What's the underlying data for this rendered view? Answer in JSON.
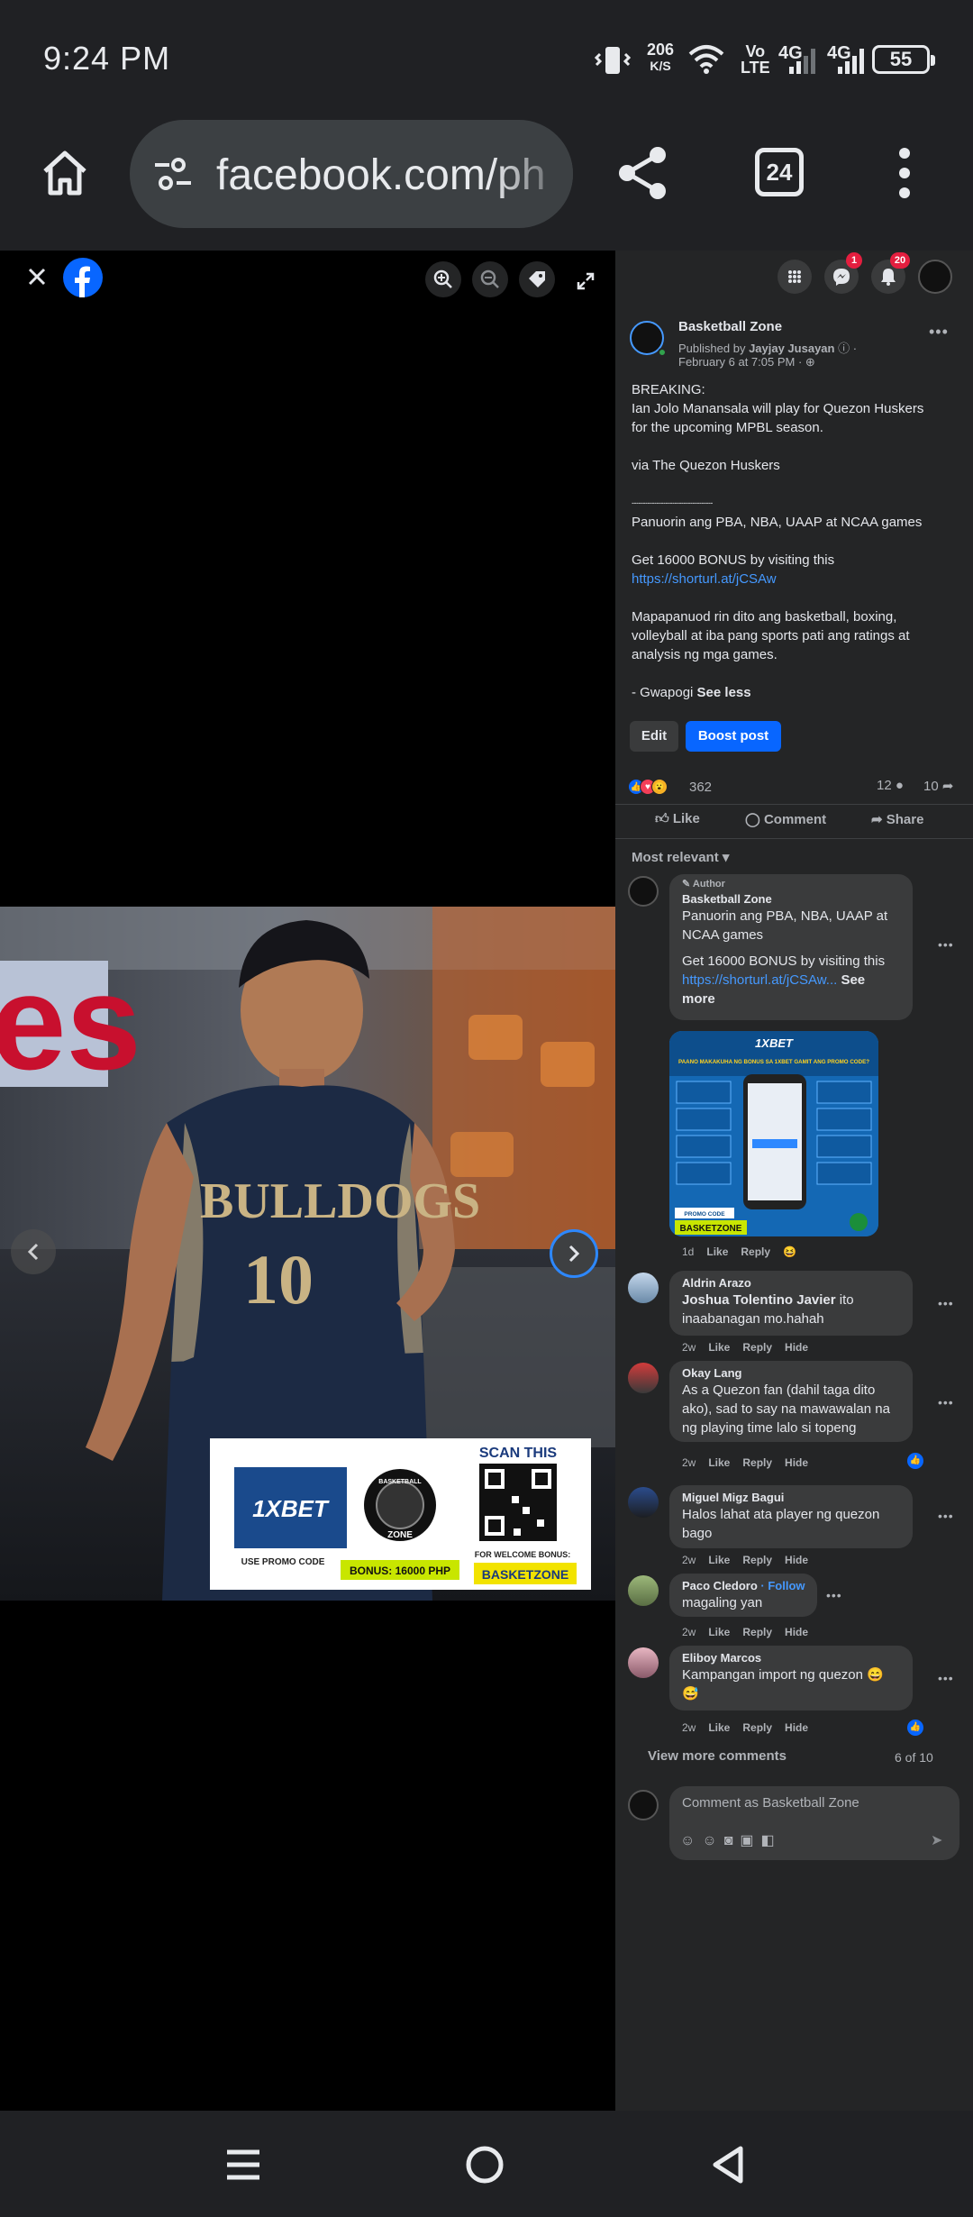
{
  "status_bar": {
    "time": "9:24 PM",
    "net_speed_top": "206",
    "net_speed_bottom": "K/S",
    "volte_top": "Vo",
    "volte_bottom": "LTE",
    "sig1": "4G",
    "sig2": "4G",
    "battery": "55"
  },
  "browser": {
    "url": "facebook.com/ph",
    "tab_count": "24"
  },
  "viewer": {
    "graphic": {
      "jersey_name": "BULLDOGS",
      "jersey_number": "10",
      "brand": "1XBET",
      "promo_label": "USE PROMO CODE",
      "badge_line1": "BASKETBALL",
      "badge_line2": "ZONE",
      "bonus": "BONUS: 16000 PHP",
      "scan": "SCAN THIS",
      "welcome": "FOR WELCOME BONUS:",
      "code": "BASKETZONE",
      "bg_letters": "es"
    }
  },
  "topbar": {
    "messenger_badge": "1",
    "notifications_badge": "20"
  },
  "post": {
    "page_name": "Basketball Zone",
    "published_prefix": "Published by ",
    "publisher": "Jayjay Jusayan",
    "date": "February 6 at 7:05 PM",
    "lines": [
      "BREAKING:",
      "Ian Jolo Manansala will play for Quezon Huskers",
      "for the upcoming MPBL season.",
      "",
      "via The Quezon Huskers",
      "",
      "------------------------------------",
      "Panuorin ang PBA, NBA, UAAP at NCAA games",
      "",
      "Get 16000 BONUS by visiting this"
    ],
    "link": "https://shorturl.at/jCSAw",
    "lines2": [
      "Mapapanuod rin dito ang basketball, boxing,",
      "volleyball at iba pang sports pati ang ratings at",
      "analysis ng mga games.",
      ""
    ],
    "signature": "- Gwapogi ",
    "see_less": "See less",
    "edit": "Edit",
    "boost": "Boost post",
    "reactions_count": "362",
    "comments_count": "12",
    "shares_count": "10",
    "like": "Like",
    "comment": "Comment",
    "share": "Share",
    "sort": "Most relevant"
  },
  "comments": [
    {
      "author_tag": "Author",
      "name": "Basketball Zone",
      "lines": [
        "Panuorin ang PBA, NBA, UAAP at",
        "NCAA games",
        "",
        "Get 16000 BONUS by visiting this"
      ],
      "link": "https://shorturl.at/jCSAw...",
      "see_more_a": " See",
      "see_more_b": "more",
      "img_brand": "1XBET",
      "img_title": "PAANO MAKAKUHA NG BONUS SA 1XBET GAMIT ANG PROMO CODE?",
      "img_promo": "PROMO CODE",
      "img_code": "BASKETZONE",
      "time": "1d",
      "like": "Like",
      "reply": "Reply",
      "reaction": "😆"
    },
    {
      "name": "Aldrin Arazo",
      "mention": "Joshua Tolentino Javier",
      "text_after_mention": " ito",
      "line2": "inaabanagan mo.hahah",
      "time": "2w",
      "like": "Like",
      "reply": "Reply",
      "hide": "Hide"
    },
    {
      "name": "Okay Lang",
      "lines": [
        "As a Quezon fan (dahil taga dito",
        "ako), sad to say na mawawalan na",
        "ng playing time lalo si topeng"
      ],
      "time": "2w",
      "like": "Like",
      "reply": "Reply",
      "hide": "Hide"
    },
    {
      "name": "Miguel Migz Bagui",
      "lines": [
        "Halos lahat ata player ng quezon",
        "bago"
      ],
      "time": "2w",
      "like": "Like",
      "reply": "Reply",
      "hide": "Hide"
    },
    {
      "name": "Paco Cledoro",
      "follow": "Follow",
      "lines": [
        "magaling yan"
      ],
      "time": "2w",
      "like": "Like",
      "reply": "Reply",
      "hide": "Hide"
    },
    {
      "name": "Eliboy Marcos",
      "lines": [
        "Kampangan import ng quezon 😄",
        "😅"
      ],
      "time": "2w",
      "like": "Like",
      "reply": "Reply",
      "hide": "Hide"
    }
  ],
  "view_more": "View more comments",
  "pagination": "6 of 10",
  "composer_placeholder": "Comment as Basketball Zone",
  "colors": {
    "fb_blue": "#0866ff",
    "panel_bg": "#242526",
    "bubble": "#3a3b3c",
    "link": "#4599ff",
    "badge_red": "#e41e3f"
  }
}
